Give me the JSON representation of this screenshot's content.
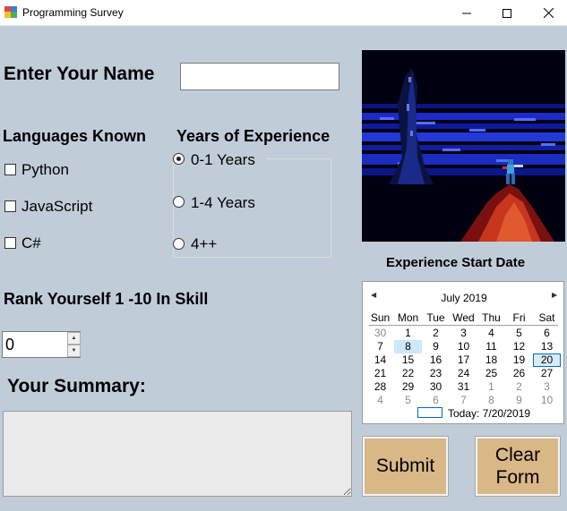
{
  "window": {
    "title": "Programming Survey",
    "minimize_glyph": "—",
    "maximize_glyph": "☐",
    "close_glyph": "✕"
  },
  "name": {
    "label": "Enter Your Name",
    "value": ""
  },
  "languages": {
    "label": "Languages Known",
    "options": [
      {
        "label": "Python",
        "checked": false
      },
      {
        "label": "JavaScript",
        "checked": false
      },
      {
        "label": "C#",
        "checked": false
      }
    ]
  },
  "experience": {
    "label": "Years of Experience",
    "options": [
      {
        "label": "0-1 Years",
        "selected": true
      },
      {
        "label": "1-4 Years",
        "selected": false
      },
      {
        "label": "4++",
        "selected": false
      }
    ]
  },
  "rank": {
    "label": "Rank Yourself 1 -10 In Skill",
    "value": "0",
    "up_glyph": "▲",
    "down_glyph": "▼"
  },
  "summary": {
    "label": "Your Summary:",
    "value": ""
  },
  "calendar": {
    "label": "Experience Start Date",
    "month": "July 2019",
    "prev_glyph": "◀",
    "next_glyph": "▶",
    "days_of_week": [
      "Sun",
      "Mon",
      "Tue",
      "Wed",
      "Thu",
      "Fri",
      "Sat"
    ],
    "weeks": [
      [
        "30",
        "1",
        "2",
        "3",
        "4",
        "5",
        "6"
      ],
      [
        "7",
        "8",
        "9",
        "10",
        "11",
        "12",
        "13"
      ],
      [
        "14",
        "15",
        "16",
        "17",
        "18",
        "19",
        "20"
      ],
      [
        "21",
        "22",
        "23",
        "24",
        "25",
        "26",
        "27"
      ],
      [
        "28",
        "29",
        "30",
        "31",
        "1",
        "2",
        "3"
      ],
      [
        "4",
        "5",
        "6",
        "7",
        "8",
        "9",
        "10"
      ]
    ],
    "today_label": "Today: 7/20/2019"
  },
  "buttons": {
    "submit": "Submit",
    "clear_line1": "Clear",
    "clear_line2": "Form"
  },
  "colors": {
    "window_background": "#c0cdd9",
    "button_fill": "#d9b787",
    "picture_sky": "#0a1a9a"
  }
}
